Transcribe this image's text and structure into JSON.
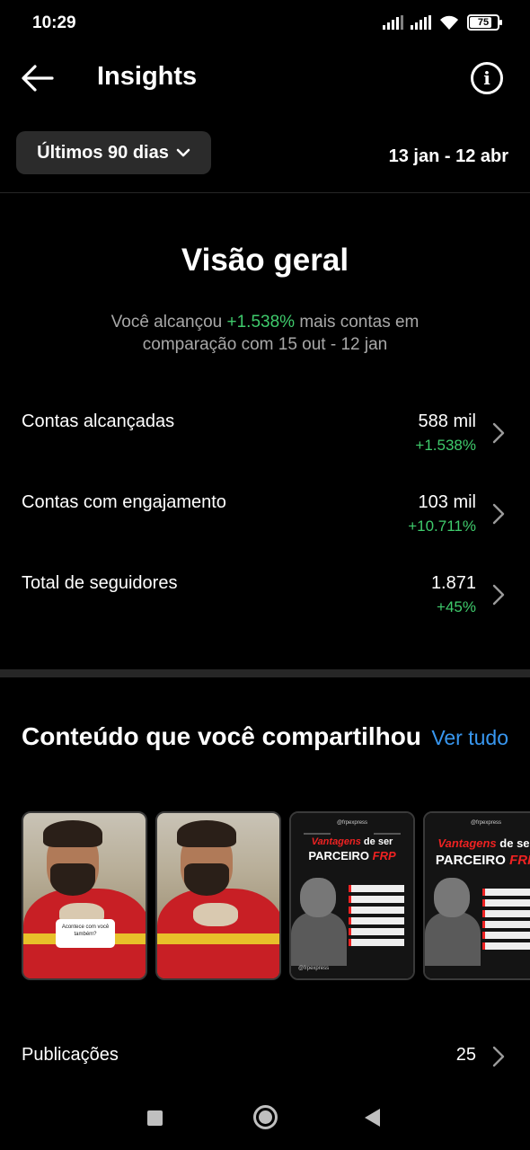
{
  "status_bar": {
    "time": "10:29",
    "battery": "75"
  },
  "header": {
    "title": "Insights"
  },
  "filter": {
    "period": "Últimos 90 dias",
    "date_range": "13 jan - 12 abr"
  },
  "overview": {
    "title": "Visão geral",
    "sub_before": "Você alcançou ",
    "sub_highlight": "+1.538%",
    "sub_after": " mais contas em comparação com 15 out - 12 jan",
    "metrics": [
      {
        "label": "Contas alcançadas",
        "value": "588 mil",
        "change": "+1.538%"
      },
      {
        "label": "Contas com engajamento",
        "value": "103 mil",
        "change": "+10.711%"
      },
      {
        "label": "Total de seguidores",
        "value": "1.871",
        "change": "+45%"
      }
    ]
  },
  "content": {
    "title": "Conteúdo que você compartilhou",
    "see_all": "Ver tudo",
    "thumb1_sticker": "Acontece com você também?",
    "poster": {
      "handle": "@frpexpress",
      "line1_red": "Vantagens",
      "line1_white": " de ser",
      "line2_white": "PARCEIRO ",
      "line2_red": "FRP",
      "footer": "@frpexpress"
    },
    "publications_label": "Publicações",
    "publications_count": "25"
  },
  "colors": {
    "accent_green": "#3fcb6c",
    "link_blue": "#3897f0",
    "background": "#000000"
  }
}
